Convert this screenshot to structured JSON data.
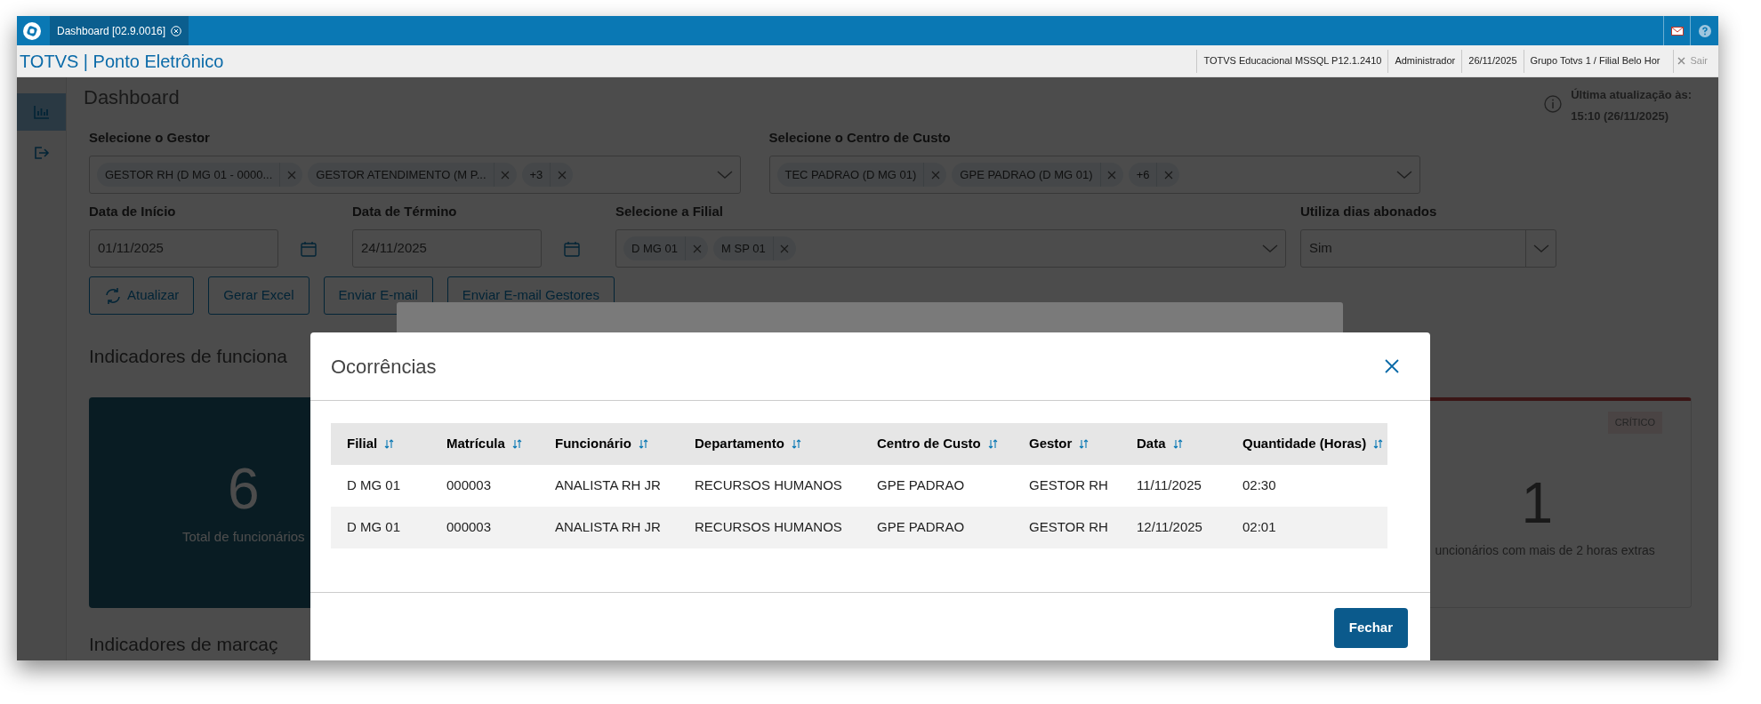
{
  "top_bar": {
    "tabs": [
      {
        "label": "Dashboard [02.9.0016]",
        "selected": true
      }
    ]
  },
  "header": {
    "title": "TOTVS | Ponto Eletrônico",
    "info": [
      "TOTVS Educacional MSSQL P12.1.2410",
      "Administrador",
      "26/11/2025",
      "Grupo Totvs 1 / Filial Belo Hor"
    ],
    "logout": "Sair"
  },
  "sidebar": {
    "items": [
      {
        "kind": "chart",
        "selected": true
      },
      {
        "kind": "logout",
        "selected": false
      }
    ]
  },
  "dashboard": {
    "title": "Dashboard",
    "last_update": {
      "label": "Última atualização às:",
      "value": "15:10 (26/11/2025)"
    },
    "filter_rows": [
      [
        {
          "kind": "multiselect",
          "label": "Selecione o Gestor",
          "chips": [
            "GESTOR RH (D MG 01 - 0000...",
            "GESTOR ATENDIMENTO (M P...",
            "+3"
          ]
        },
        {
          "kind": "multiselect",
          "label": "Selecione o Centro de Custo",
          "chips": [
            "TEC PADRAO (D MG 01)",
            "GPE PADRAO (D MG 01)",
            "+6"
          ]
        }
      ],
      [
        {
          "kind": "date",
          "label": "Data de Início",
          "value": "01/11/2025"
        },
        {
          "kind": "date",
          "label": "Data de Término",
          "value": "24/11/2025"
        },
        {
          "kind": "multiselect",
          "label": "Selecione a Filial",
          "chips": [
            "D MG 01",
            "M SP 01"
          ]
        },
        {
          "kind": "select",
          "label": "Utiliza dias abonados",
          "value": "Sim"
        }
      ]
    ],
    "buttons": [
      {
        "kind": "refresh",
        "label": "Atualizar"
      },
      {
        "kind": "plain",
        "label": "Gerar Excel"
      },
      {
        "kind": "plain",
        "label": "Enviar E-mail"
      },
      {
        "kind": "plain",
        "label": "Enviar E-mail Gestores"
      }
    ],
    "sections": [
      {
        "heading": "Indicadores de funciona",
        "cards": [
          {
            "kind": "highlight",
            "value": "6",
            "label": "Total de funcionários"
          },
          {
            "kind": "critical",
            "badge": "CRÍTICO",
            "value": "1",
            "label": "uncionários com mais de 2 horas extras"
          }
        ]
      },
      {
        "heading": "Indicadores de marcaç"
      }
    ]
  },
  "modal": {
    "title": "Ocorrências",
    "table": {
      "columns": [
        "Filial",
        "Matrícula",
        "Funcionário",
        "Departamento",
        "Centro de Custo",
        "Gestor",
        "Data",
        "Quantidade (Horas)"
      ],
      "rows": [
        [
          "D MG 01",
          "000003",
          "ANALISTA RH JR",
          "RECURSOS HUMANOS",
          "GPE PADRAO",
          "GESTOR RH",
          "11/11/2025",
          "02:30"
        ],
        [
          "D MG 01",
          "000003",
          "ANALISTA RH JR",
          "RECURSOS HUMANOS",
          "GPE PADRAO",
          "GESTOR RH",
          "12/11/2025",
          "02:01"
        ]
      ]
    },
    "buttons": [
      "Fechar"
    ]
  }
}
